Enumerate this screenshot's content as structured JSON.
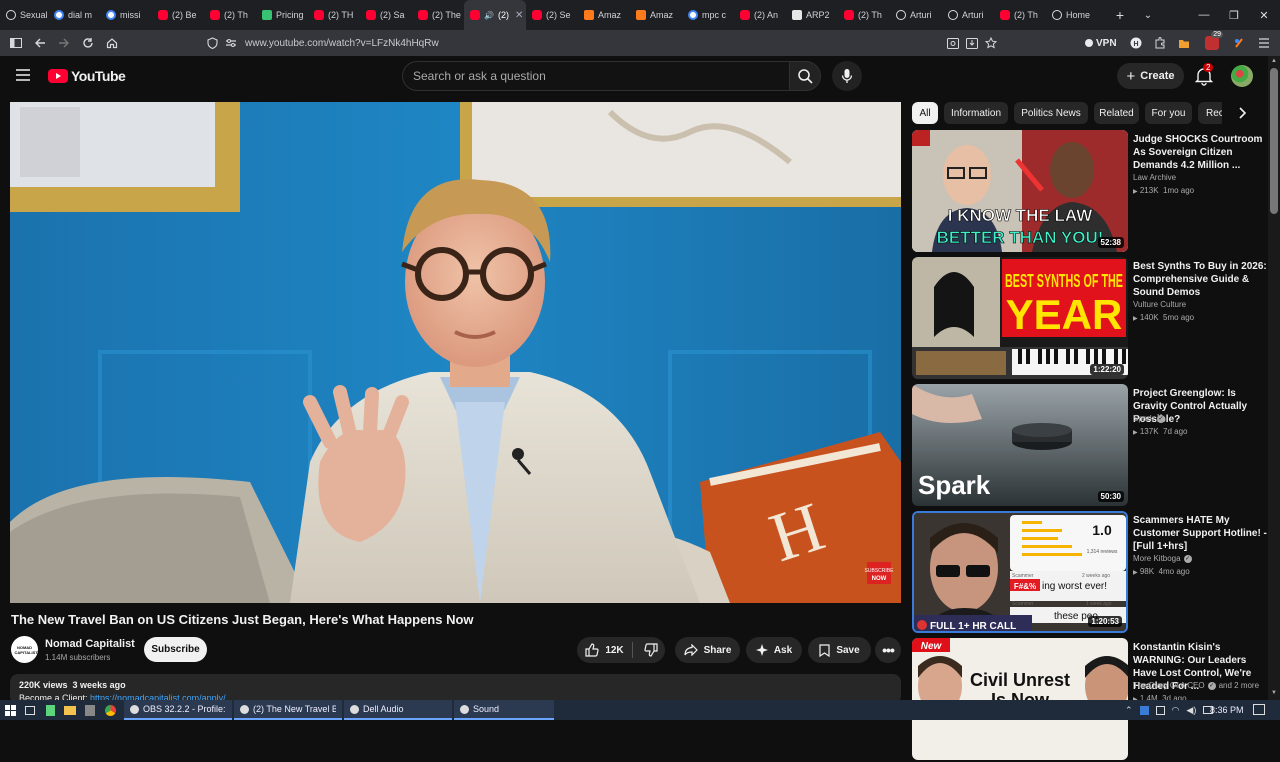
{
  "browser": {
    "tabs": [
      {
        "label": "Sexual",
        "icon": "globe-icon"
      },
      {
        "label": "dial m",
        "icon": "google-icon"
      },
      {
        "label": "missi",
        "icon": "google-icon"
      },
      {
        "label": "(2) Be",
        "icon": "youtube-icon"
      },
      {
        "label": "(2) Th",
        "icon": "youtube-icon"
      },
      {
        "label": "Pricing",
        "icon": "page-icon"
      },
      {
        "label": "(2) TH",
        "icon": "youtube-icon"
      },
      {
        "label": "(2) Sa",
        "icon": "youtube-icon"
      },
      {
        "label": "(2) The",
        "icon": "youtube-icon"
      },
      {
        "label": "(2)",
        "icon": "youtube-icon",
        "active": true
      },
      {
        "label": "(2) Se",
        "icon": "youtube-icon"
      },
      {
        "label": "Amaz",
        "icon": "amazon-icon"
      },
      {
        "label": "Amaz",
        "icon": "amazon-icon"
      },
      {
        "label": "mpc c",
        "icon": "google-icon"
      },
      {
        "label": "(2) An",
        "icon": "youtube-icon"
      },
      {
        "label": "ARP2",
        "icon": "doc-icon"
      },
      {
        "label": "(2) Th",
        "icon": "youtube-icon"
      },
      {
        "label": "Arturi",
        "icon": "arturia-icon"
      },
      {
        "label": "Arturi",
        "icon": "arturia-icon"
      },
      {
        "label": "(2) Th",
        "icon": "youtube-icon"
      },
      {
        "label": "Home",
        "icon": "web-icon"
      }
    ],
    "url": "www.youtube.com/watch?v=LFzNk4hHqRw",
    "vpn_label": "VPN",
    "notification_badge": "29"
  },
  "youtube": {
    "logo_text": "YouTube",
    "search_placeholder": "Search or ask a question",
    "create_label": "Create",
    "notif_count": "2"
  },
  "video": {
    "title": "The New Travel Ban on US Citizens Just Began, Here's What Happens Now",
    "channel": "Nomad Capitalist",
    "subscribers": "1.14M subscribers",
    "subscribe_label": "Subscribe",
    "likes": "12K",
    "share_label": "Share",
    "ask_label": "Ask",
    "save_label": "Save",
    "views": "220K views",
    "posted": "3 weeks ago",
    "desc_prefix": "Become a Client: ",
    "desc_link": "https://nomadcapitalist.com/apply/",
    "channel_avatar_text": "NOMAD CAPITALIST"
  },
  "chips": [
    "All",
    "Information",
    "Politics News",
    "Related",
    "For you",
    "Rec"
  ],
  "recommendations": [
    {
      "title": "Judge SHOCKS Courtroom As Sovereign Citizen Demands 4.2 Million ...",
      "channel": "Law Archive",
      "verified": false,
      "views": "213K",
      "age": "1mo ago",
      "duration": "52:38",
      "thumb_text_1": "I KNOW THE LAW",
      "thumb_text_2": "BETTER THAN YOU!"
    },
    {
      "title": "Best Synths To Buy in 2026: Comprehensive Guide & Sound Demos",
      "channel": "Vulture Culture",
      "verified": false,
      "views": "140K",
      "age": "5mo ago",
      "duration": "1:22:20",
      "thumb_text_1": "BEST SYNTHS OF THE",
      "thumb_text_2": "YEAR"
    },
    {
      "title": "Project Greenglow: Is Gravity Control Actually Possible?",
      "channel": "Spark",
      "verified": true,
      "views": "137K",
      "age": "7d ago",
      "duration": "50:30",
      "thumb_text_1": "Spark"
    },
    {
      "title": "Scammers HATE My Customer Support Hotline! - [Full 1+hrs]",
      "channel": "More Kitboga",
      "verified": true,
      "views": "98K",
      "age": "4mo ago",
      "duration": "1:20:53",
      "thumb_text_1": "FULL 1+ HR CALL",
      "thumb_text_2": "1.0",
      "thumb_text_3": "ing worst ever!",
      "thumb_text_4": "these peo",
      "thumb_text_5": "Scammer",
      "thumb_text_6": "1,314 reviews",
      "thumb_text_7": "F#&%",
      "thumb_text_8": "2 weeks ago",
      "thumb_text_9": "1 week ago"
    },
    {
      "title": "Konstantin Kisin's WARNING: Our Leaders Have Lost Control, We're Headed For ...",
      "channel": "The Diary Of A CEO",
      "channel_extra": "and 2 more",
      "verified": true,
      "views": "1.4M",
      "age": "3d ago",
      "thumb_text_1": "New",
      "thumb_text_2": "Civil Unrest",
      "thumb_text_3": "Is Now"
    }
  ],
  "taskbar": {
    "apps": [
      {
        "label": "OBS 32.2.2 - Profile: U...",
        "icon": "obs-icon"
      },
      {
        "label": "(2) The New Travel Ba...",
        "icon": "browser-icon"
      },
      {
        "label": "Dell Audio",
        "icon": "speaker-icon"
      },
      {
        "label": "Sound",
        "icon": "speaker-icon"
      }
    ],
    "time": "8:36 PM"
  },
  "colors": {
    "yt_red": "#ff0033",
    "bg": "#0f0f0f",
    "chip": "#272727"
  }
}
